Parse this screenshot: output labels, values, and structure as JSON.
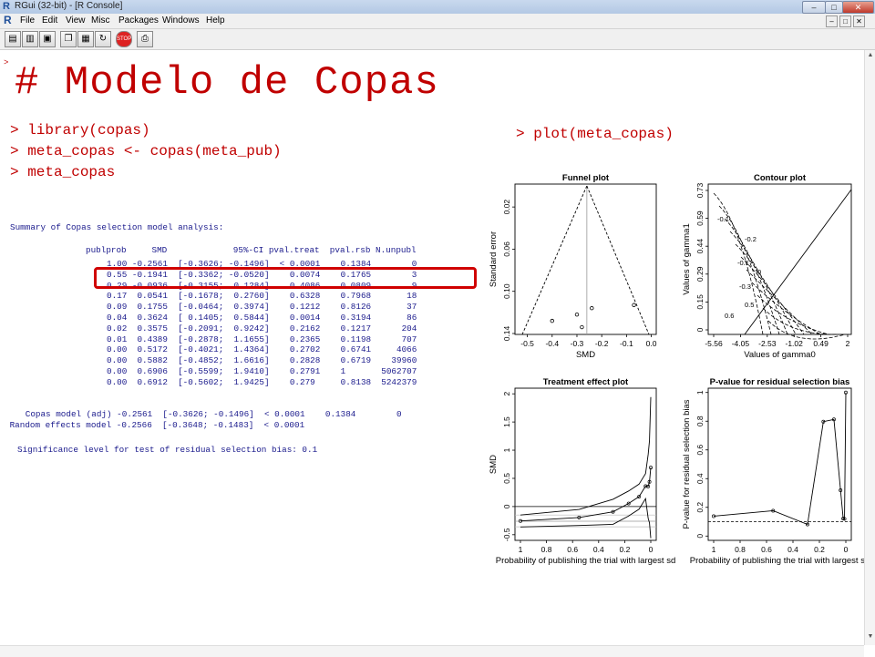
{
  "window": {
    "title": "RGui (32-bit) - [R Console]",
    "logo": "R",
    "controls": [
      "–",
      "□",
      "✕"
    ]
  },
  "menubar": {
    "items": [
      "File",
      "Edit",
      "View",
      "Misc",
      "Packages",
      "Windows",
      "Help"
    ]
  },
  "toolbar": {
    "buttons": [
      "open-script-icon",
      "load-workspace-icon",
      "save-workspace-icon",
      "copy-icon",
      "paste-icon",
      "copy-paste-icon",
      "stop-icon",
      "print-icon"
    ],
    "stop_label": "STOP"
  },
  "console": {
    "prompt_small": ">",
    "heading": "# Modelo de Copas",
    "commands": [
      "> library(copas)",
      "> meta_copas <- copas(meta_pub)",
      "> meta_copas"
    ],
    "plot_command": "> plot(meta_copas)",
    "summary_title": "Summary of Copas selection model analysis:",
    "table_header": "publprob     SMD             95%-CI pval.treat  pval.rsb N.unpubl",
    "table_rows": [
      "1.00 -0.2561  [-0.3626; -0.1496]  < 0.0001    0.1384        0",
      "0.55 -0.1941  [-0.3362; -0.0520]    0.0074    0.1765        3",
      "0.29 -0.0936  [-0.3155;  0.1284]    0.4086    0.0809        9",
      "0.17  0.0541  [-0.1678;  0.2760]    0.6328    0.7968       18",
      "0.09  0.1755  [-0.0464;  0.3974]    0.1212    0.8126       37",
      "0.04  0.3624  [ 0.1405;  0.5844]    0.0014    0.3194       86",
      "0.02  0.3575  [-0.2091;  0.9242]    0.2162    0.1217      204",
      "0.01  0.4389  [-0.2878;  1.1655]    0.2365    0.1198      707",
      "0.00  0.5172  [-0.4021;  1.4364]    0.2702    0.6741     4066",
      "0.00  0.5882  [-0.4852;  1.6616]    0.2828    0.6719    39960",
      "0.00  0.6906  [-0.5599;  1.9410]    0.2791    1       5062707",
      "0.00  0.6912  [-0.5602;  1.9425]    0.279     0.8138  5242379"
    ],
    "model_rows": [
      "   Copas model (adj) -0.2561  [-0.3626; -0.1496]  < 0.0001    0.1384        0",
      " Random effects model -0.2566  [-0.3648; -0.1483]  < 0.0001"
    ],
    "significance": "Significance level for test of residual selection bias: 0.1"
  },
  "chart_data": [
    {
      "type": "scatter",
      "title": "Funnel plot",
      "xlabel": "SMD",
      "ylabel": "Standard error",
      "xlim": [
        -0.55,
        0.02
      ],
      "ylim": [
        0.14,
        0
      ],
      "xticks": [
        "-0.5",
        "-0.4",
        "-0.3",
        "-0.2",
        "-0.1",
        "0.0"
      ],
      "yticks": [
        "0.02",
        "0.06",
        "0.10",
        "0.14"
      ],
      "points": [
        [
          -0.4,
          0.128
        ],
        [
          -0.3,
          0.122
        ],
        [
          -0.28,
          0.134
        ],
        [
          -0.24,
          0.116
        ],
        [
          -0.07,
          0.113
        ]
      ],
      "center": -0.26
    },
    {
      "type": "line",
      "title": "Contour plot",
      "xlabel": "Values of gamma0",
      "ylabel": "Values of gamma1",
      "xticks": [
        "-5.56",
        "-4.05",
        "-2.53",
        "-1.02",
        "0.49",
        "2"
      ],
      "yticks": [
        "0",
        "0.15",
        "0.29",
        "0.44",
        "0.59",
        "0.73"
      ],
      "contour_labels": [
        "-0.1",
        "-0.2",
        "-0.1",
        "0",
        "-0.3",
        "0.5",
        "0.6"
      ]
    },
    {
      "type": "line",
      "title": "Treatment effect plot",
      "xlabel": "Probability of publishing the trial with largest sd",
      "ylabel": "SMD",
      "xlim": [
        1,
        0
      ],
      "ylim": [
        -0.6,
        2.1
      ],
      "xticks": [
        "1",
        "0.8",
        "0.6",
        "0.4",
        "0.2",
        "0"
      ],
      "yticks": [
        "-0.5",
        "0",
        "0.5",
        "1",
        "1.5",
        "2"
      ],
      "x": [
        1.0,
        0.55,
        0.29,
        0.17,
        0.09,
        0.04,
        0.02,
        0.01,
        0.0
      ],
      "series": [
        {
          "values": [
            -0.2561,
            -0.1941,
            -0.0936,
            0.0541,
            0.1755,
            0.3624,
            0.3575,
            0.4389,
            0.6912
          ]
        },
        {
          "values": [
            -0.1496,
            -0.052,
            0.1284,
            0.276,
            0.3974,
            0.5844,
            0.9242,
            1.1655,
            1.9425
          ]
        },
        {
          "values": [
            -0.3626,
            -0.3362,
            -0.3155,
            -0.1678,
            -0.0464,
            0.1405,
            -0.2091,
            -0.2878,
            -0.5602
          ]
        }
      ]
    },
    {
      "type": "line",
      "title": "P-value for residual selection bias",
      "xlabel": "Probability of publishing the trial with largest sd",
      "ylabel": "P-value for residual selection bias",
      "xlim": [
        1,
        0
      ],
      "ylim": [
        0,
        1
      ],
      "xticks": [
        "1",
        "0.8",
        "0.6",
        "0.4",
        "0.2",
        "0"
      ],
      "yticks": [
        "0",
        "0.2",
        "0.4",
        "0.6",
        "0.8",
        "1"
      ],
      "x": [
        1.0,
        0.55,
        0.29,
        0.17,
        0.09,
        0.04,
        0.02,
        0.01,
        0.0
      ],
      "values": [
        0.1384,
        0.1765,
        0.0809,
        0.7968,
        0.8126,
        0.3194,
        0.1217,
        0.1198,
        1.0
      ],
      "threshold": 0.1
    }
  ]
}
